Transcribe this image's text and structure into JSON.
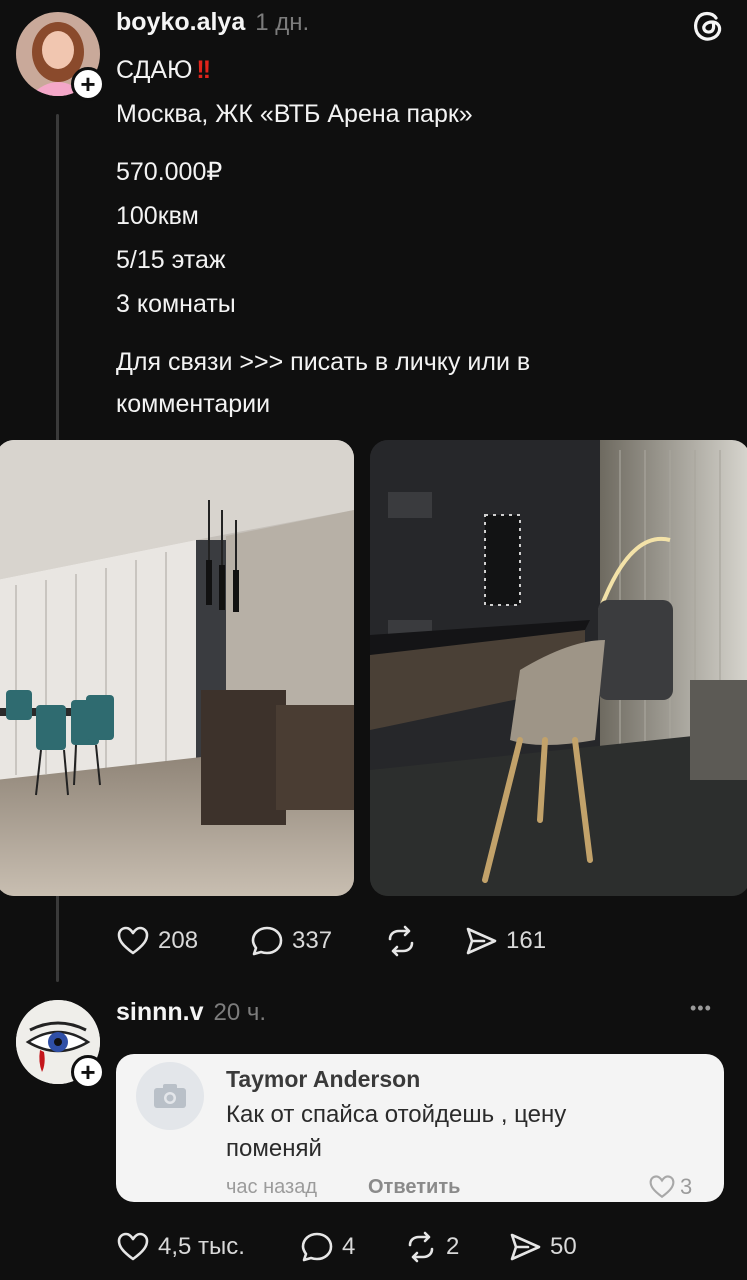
{
  "post": {
    "username": "boyko.alya",
    "time": "1 дн.",
    "title": "СДАЮ",
    "title_emoji": "‼️",
    "location": "Москва, ЖК «ВТБ Арена парк»",
    "details": [
      "570.000₽",
      "100квм",
      "5/15 этаж",
      "3 комнаты"
    ],
    "contact_line1": "Для связи >>> писать в личку или в",
    "contact_line2": "комментарии",
    "likes": "208",
    "comments": "337",
    "shares": "161"
  },
  "reply": {
    "username": "sinnn.v",
    "time": "20 ч.",
    "more": "•••",
    "card": {
      "name": "Taymor Anderson",
      "text_line1": "Как от спайса отойдешь , цену",
      "text_line2": "поменяй",
      "meta": "час назад",
      "reply_label": "Ответить",
      "likes": "3"
    },
    "likes": "4,5 тыс.",
    "comments": "4",
    "reposts": "2",
    "shares": "50"
  },
  "icons": [
    "threads-logo-icon",
    "plus-icon",
    "heart-icon",
    "comment-icon",
    "repost-icon",
    "share-icon",
    "camera-icon",
    "more-icon"
  ],
  "colors": {
    "background": "#0f0f0f",
    "text": "#f3f3f3",
    "muted": "#7c7c7c",
    "card": "#f4f4f4"
  }
}
